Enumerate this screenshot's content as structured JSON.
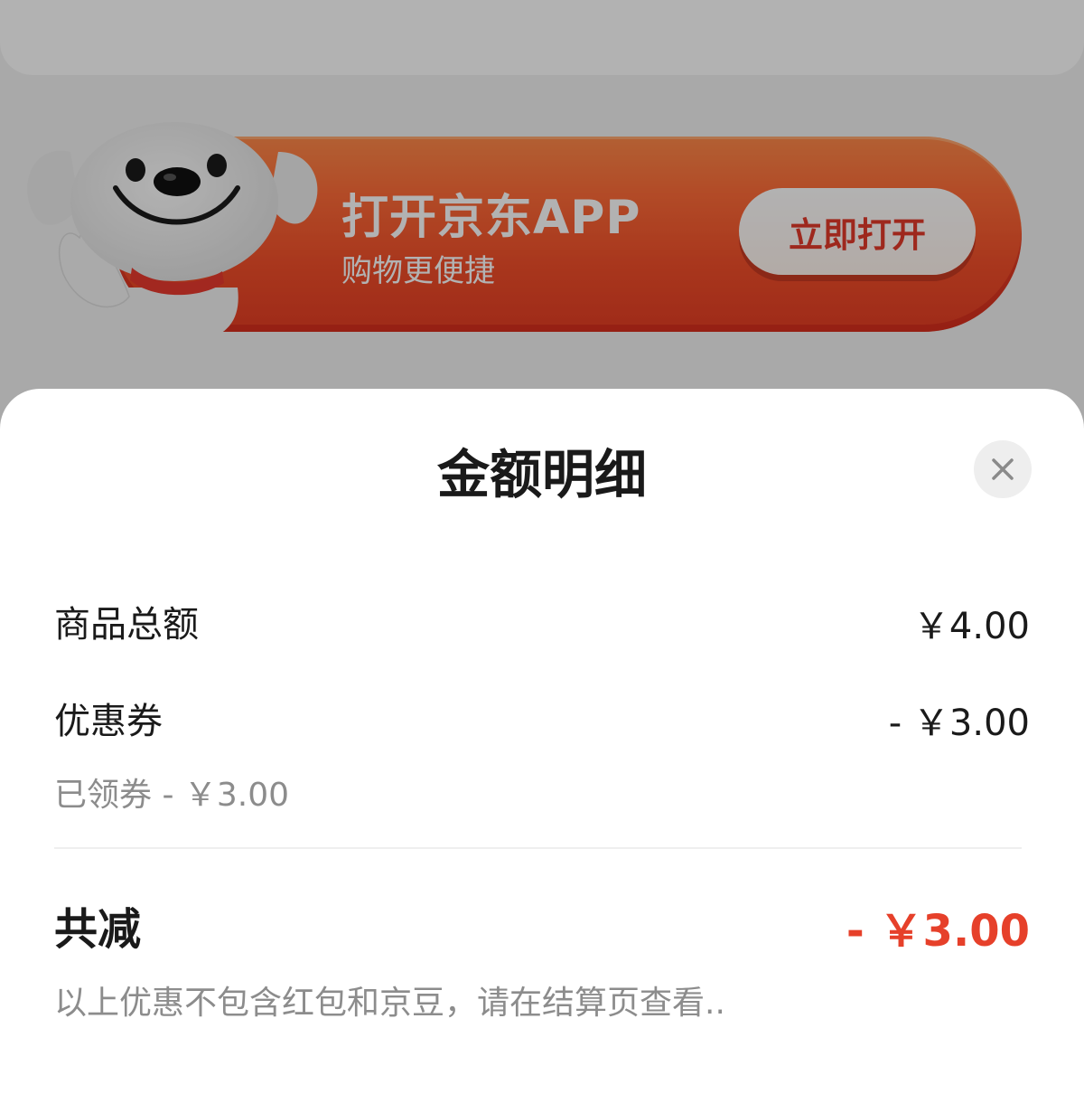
{
  "banner": {
    "title": "打开京东APP",
    "subtitle": "购物更便捷",
    "button_label": "立即打开"
  },
  "sheet": {
    "title": "金额明细",
    "close_icon": "close-icon",
    "rows": [
      {
        "label": "商品总额",
        "value": "￥4.00"
      },
      {
        "label": "优惠券",
        "value": "- ￥3.00"
      }
    ],
    "coupon_detail": "已领券 - ￥3.00",
    "total": {
      "label": "共减",
      "value": "- ￥3.00"
    },
    "note": "以上优惠不包含红包和京豆，请在结算页查看.."
  },
  "colors": {
    "accent": "#e6402a",
    "banner": "#f24f2a",
    "overlay": "rgba(0,0,0,0.30)"
  }
}
